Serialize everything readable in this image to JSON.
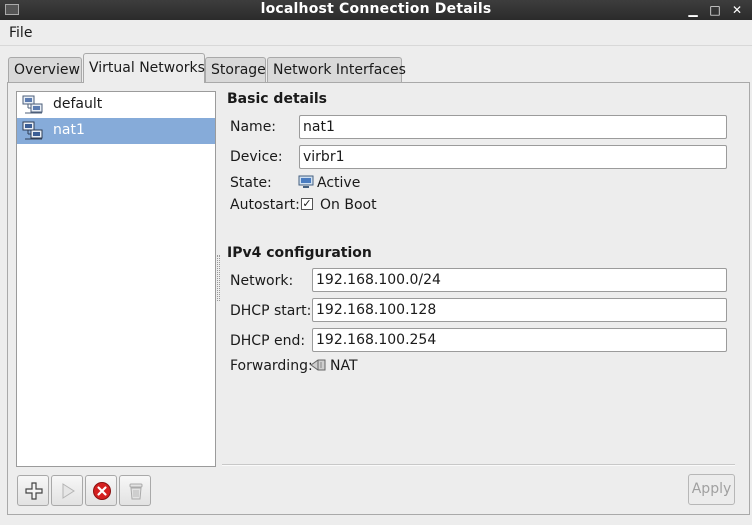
{
  "window": {
    "title": "localhost Connection Details"
  },
  "menu": {
    "file": "File"
  },
  "tabs": [
    {
      "label": "Overview",
      "active": false
    },
    {
      "label": "Virtual Networks",
      "active": true
    },
    {
      "label": "Storage",
      "active": false
    },
    {
      "label": "Network Interfaces",
      "active": false
    }
  ],
  "networks": [
    {
      "label": "default",
      "selected": false,
      "icon": "network-icon"
    },
    {
      "label": "nat1",
      "selected": true,
      "icon": "network-icon"
    }
  ],
  "basic": {
    "heading": "Basic details",
    "name_label": "Name:",
    "name_value": "nat1",
    "device_label": "Device:",
    "device_value": "virbr1",
    "state_label": "State:",
    "state_value": "Active",
    "autostart_label": "Autostart:",
    "autostart_value": "On Boot",
    "autostart_checked": true
  },
  "ipv4": {
    "heading": "IPv4 configuration",
    "network_label": "Network:",
    "network_value": "192.168.100.0/24",
    "dhcp_start_label": "DHCP start:",
    "dhcp_start_value": "192.168.100.128",
    "dhcp_end_label": "DHCP end:",
    "dhcp_end_value": "192.168.100.254",
    "forwarding_label": "Forwarding:",
    "forwarding_value": "NAT"
  },
  "toolbar": {
    "add_icon": "plus-icon",
    "start_icon": "play-icon",
    "stop_icon": "stop-icon",
    "delete_icon": "trash-icon"
  },
  "actions": {
    "apply": "Apply"
  },
  "colors": {
    "selection": "#86abd9",
    "titlebar": "#2b2b2b",
    "stop_red": "#d42020"
  }
}
